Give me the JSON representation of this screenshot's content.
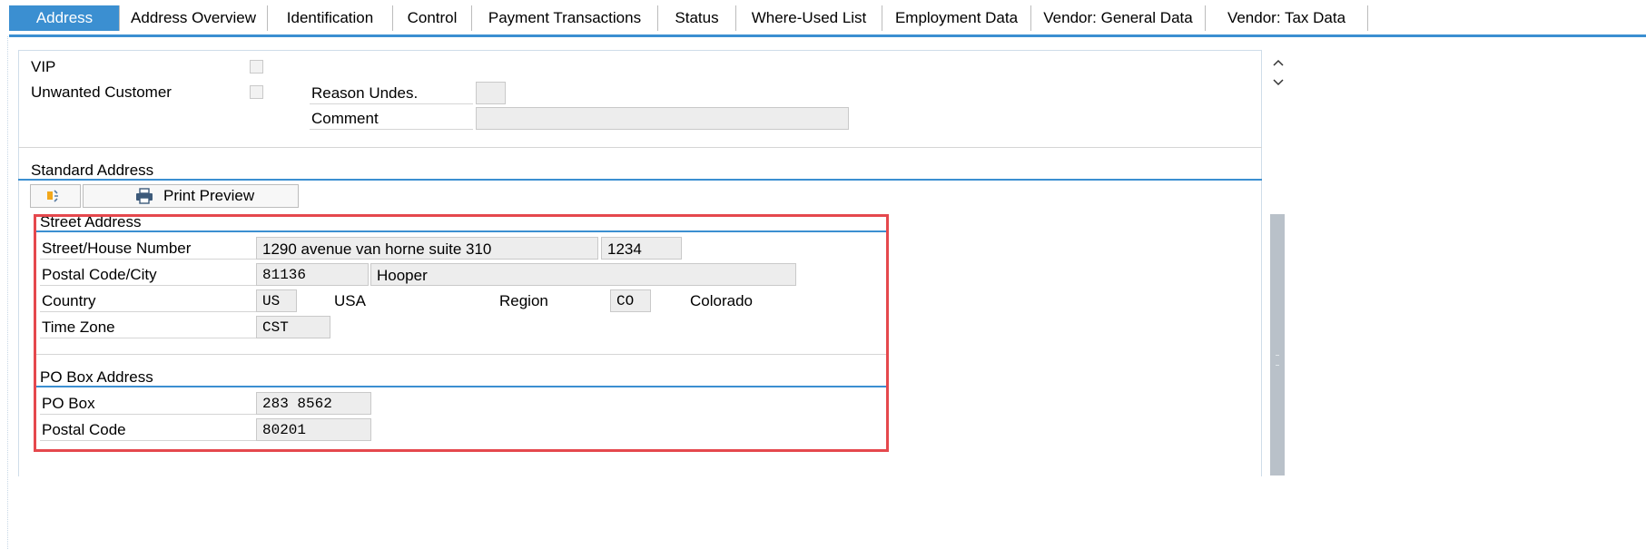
{
  "tabs": [
    {
      "label": "Address",
      "active": true
    },
    {
      "label": "Address Overview"
    },
    {
      "label": "Identification"
    },
    {
      "label": "Control"
    },
    {
      "label": "Payment Transactions"
    },
    {
      "label": "Status"
    },
    {
      "label": "Where-Used List"
    },
    {
      "label": "Employment Data"
    },
    {
      "label": "Vendor: General Data"
    },
    {
      "label": "Vendor: Tax Data"
    }
  ],
  "flags": {
    "vip_label": "VIP",
    "unwanted_label": "Unwanted Customer",
    "reason_label": "Reason Undes.",
    "reason_value": "",
    "comment_label": "Comment",
    "comment_value": ""
  },
  "standard_address": {
    "title": "Standard Address",
    "print_preview_label": "Print Preview"
  },
  "street_address": {
    "title": "Street Address",
    "street_label": "Street/House Number",
    "street_value": "1290 avenue van horne suite 310",
    "house_number": "1234",
    "postal_city_label": "Postal Code/City",
    "postal_code": "81136",
    "city": "Hooper",
    "country_label": "Country",
    "country_code": "US",
    "country_name": "USA",
    "region_label": "Region",
    "region_code": "CO",
    "region_name": "Colorado",
    "timezone_label": "Time Zone",
    "timezone_value": "CST"
  },
  "po_box_address": {
    "title": "PO Box Address",
    "po_box_label": "PO Box",
    "po_box_value": "283 8562",
    "postal_code_label": "Postal Code",
    "postal_code_value": "80201"
  },
  "icons": {
    "scroll_up": "chevron-up-icon",
    "scroll_down": "chevron-down-icon",
    "address_tree": "address-tree-icon",
    "printer": "printer-icon"
  },
  "colors": {
    "accent": "#3b8fd1",
    "highlight": "#e5484d"
  }
}
